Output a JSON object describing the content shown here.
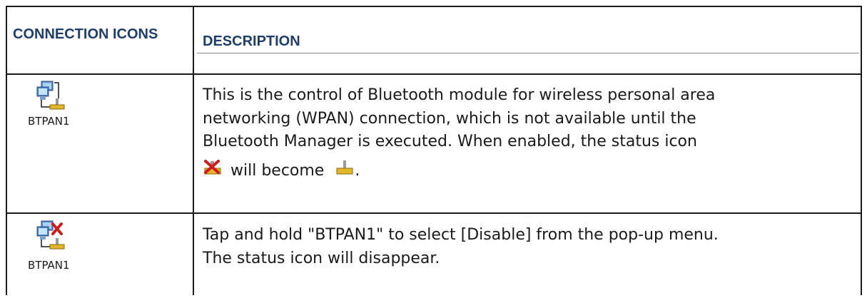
{
  "header": {
    "col1_label": "CONNECTION ICONS",
    "col2_label": "DESCRIPTION"
  },
  "rows": [
    {
      "icon": "bluetooth-network-enabled-icon",
      "icon_label": "BTPAN1",
      "description_lines": [
        "This is the control of Bluetooth module for wireless personal area",
        "networking (WPAN) connection, which is not available until the",
        "Bluetooth Manager is executed. When enabled, the status icon"
      ],
      "description_tail": {
        "icon_before": "status-disabled-icon",
        "text": "will become",
        "icon_after": "status-connected-icon",
        "end": "."
      }
    },
    {
      "icon": "bluetooth-network-disabled-icon",
      "icon_label": "BTPAN1",
      "description_lines": [
        "Tap and hold \"BTPAN1\" to select [Disable] from the pop-up menu.",
        "The status icon will disappear."
      ]
    }
  ],
  "colors": {
    "header_text": "#1f3e6b",
    "border": "#1a1a1a",
    "body_text": "#1a1a1a"
  }
}
